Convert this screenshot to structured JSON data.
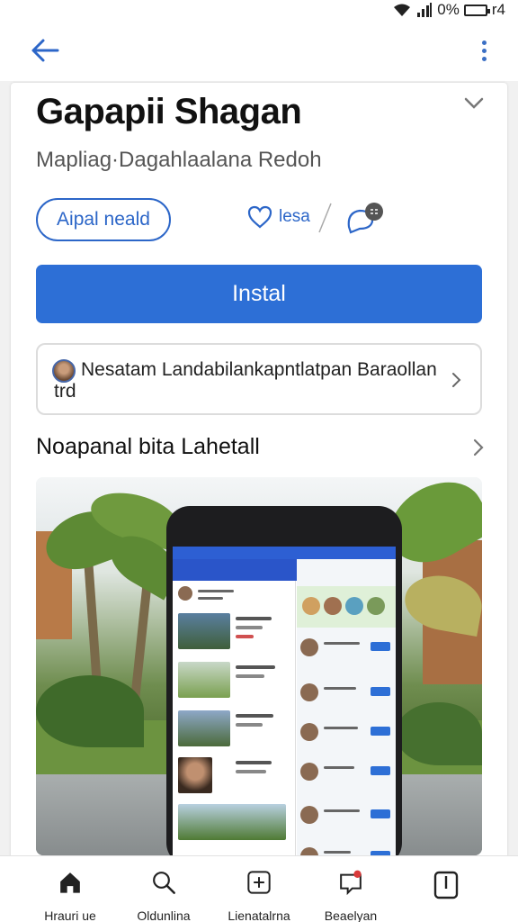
{
  "status_bar": {
    "battery_text": "0%",
    "time_fragment": "r4"
  },
  "header": {
    "back_icon": "arrow-left-icon",
    "menu_icon": "more-vertical-icon"
  },
  "app": {
    "title": "Gapapii Shagan",
    "subtitle": "Mapliag·Dagahlaalana Redoh",
    "secondary_button_label": "Aipal neald",
    "like_label": "lesa",
    "install_label": "Instal",
    "info_text": "Nesatam Landabilankapntlatpan Baraollan trd",
    "section_title": "Noapanal bita Lahetall"
  },
  "bottom_nav": {
    "items": [
      {
        "label": "Hrauri ue",
        "icon": "home-icon"
      },
      {
        "label": "Oldunlina",
        "icon": "search-icon"
      },
      {
        "label": "Lienatalrna",
        "icon": "add-box-icon"
      },
      {
        "label": "Beaelyan",
        "icon": "notifications-icon"
      },
      {
        "label": "",
        "icon": "library-icon"
      }
    ]
  },
  "colors": {
    "accent": "#2d6fd6",
    "outline_accent": "#2c66c8",
    "text_primary": "#111111",
    "text_secondary": "#555555"
  }
}
